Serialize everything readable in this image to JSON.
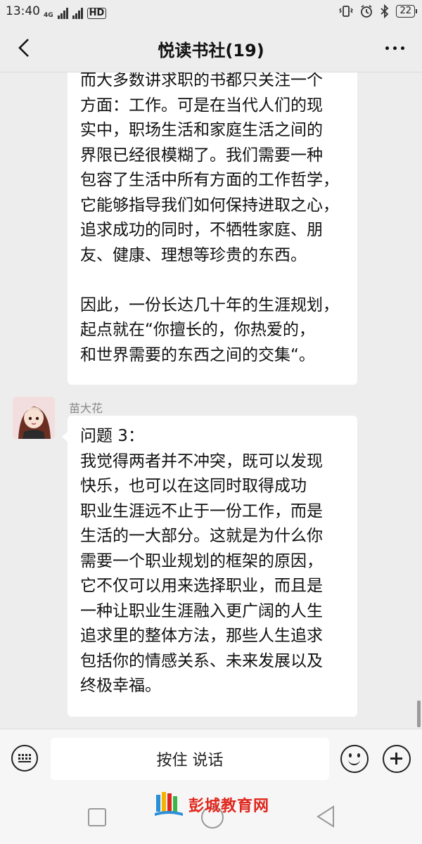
{
  "status_bar": {
    "time": "13:40",
    "network_label": "4G",
    "hd_label": "HD",
    "battery": "22",
    "icons": [
      "signal-icon",
      "wifi-off-icon",
      "vibrate-icon",
      "alarm-icon",
      "bluetooth-icon",
      "battery-icon"
    ]
  },
  "header": {
    "title": "悦读书社(19)",
    "back_icon": "chevron-left-icon",
    "more_icon": "more-dots-icon"
  },
  "messages": [
    {
      "sender": "",
      "text": "而大多数讲求职的书都只关注一个\n方面：工作。可是在当代人们的现\n实中，职场生活和家庭生活之间的\n界限已经很模糊了。我们需要一种\n包容了生活中所有方面的工作哲学，\n它能够指导我们如何保持进取之心，\n追求成功的同时，不牺牲家庭、朋\n友、健康、理想等珍贵的东西。\n\n因此，一份长达几十年的生涯规划，\n起点就在“你擅长的，你热爱的，\n和世界需要的东西之间的交集“。"
    },
    {
      "sender": "苗大花",
      "text": "问题 3：\n我觉得两者并不冲突，既可以发现\n快乐，也可以在这同时取得成功\n职业生涯远不止于一份工作，而是\n生活的一大部分。这就是为什么你\n需要一个职业规划的框架的原因，\n它不仅可以用来选择职业，而且是\n一种让职业生涯融入更广阔的人生\n追求里的整体方法，那些人生追求\n包括你的情感关系、未来发展以及\n终极幸福。"
    }
  ],
  "input_bar": {
    "hold_to_talk_label": "按住 说话",
    "icons": [
      "keyboard-icon",
      "emoji-icon",
      "plus-icon"
    ]
  },
  "watermark": {
    "text": "彭城教育网"
  },
  "colors": {
    "background": "#ededed",
    "bubble": "#ffffff",
    "watermark": "#e0271d"
  }
}
